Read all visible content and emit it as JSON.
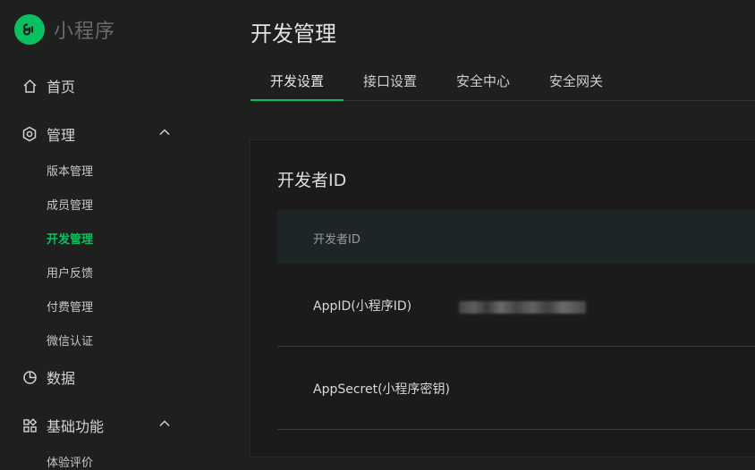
{
  "app": {
    "logo_text": "小程序",
    "brand_color": "#07c160"
  },
  "sidebar": {
    "home": {
      "label": "首页",
      "icon": "home-icon"
    },
    "manage": {
      "label": "管理",
      "icon": "hexagon-settings-icon",
      "expanded": true,
      "items": [
        {
          "label": "版本管理",
          "active": false
        },
        {
          "label": "成员管理",
          "active": false
        },
        {
          "label": "开发管理",
          "active": true
        },
        {
          "label": "用户反馈",
          "active": false
        },
        {
          "label": "付费管理",
          "active": false
        },
        {
          "label": "微信认证",
          "active": false
        }
      ]
    },
    "data": {
      "label": "数据",
      "icon": "pie-chart-icon"
    },
    "basic": {
      "label": "基础功能",
      "icon": "grid-apps-icon",
      "expanded": true,
      "items": [
        {
          "label": "体验评价",
          "active": false
        }
      ]
    }
  },
  "main": {
    "title": "开发管理",
    "tabs": [
      {
        "label": "开发设置",
        "active": true
      },
      {
        "label": "接口设置",
        "active": false
      },
      {
        "label": "安全中心",
        "active": false
      },
      {
        "label": "安全网关",
        "active": false
      }
    ],
    "card": {
      "title": "开发者ID",
      "table_header": "开发者ID",
      "rows": [
        {
          "label": "AppID(小程序ID)",
          "value_blurred": true
        },
        {
          "label": "AppSecret(小程序密钥)",
          "value_blurred": false
        }
      ]
    }
  }
}
